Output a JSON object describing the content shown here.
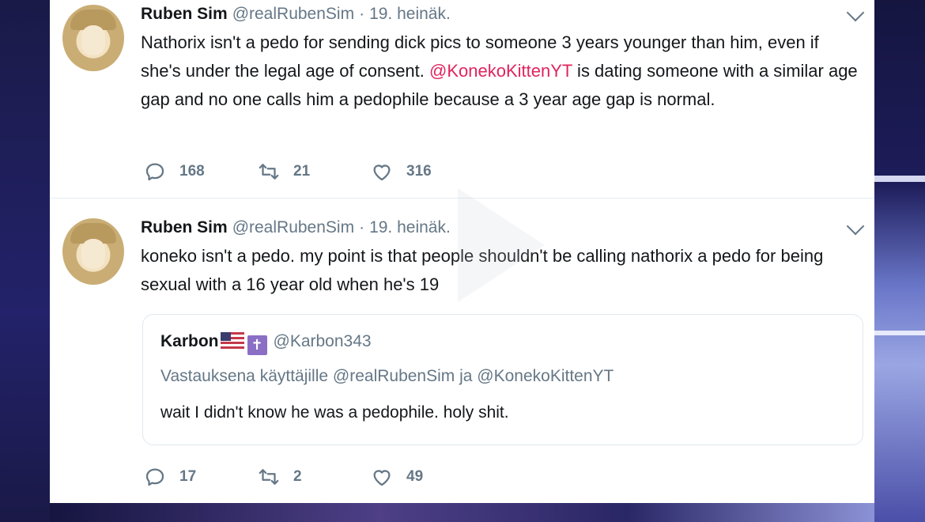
{
  "tweets": [
    {
      "author": {
        "name": "Ruben Sim",
        "handle": "@realRubenSim",
        "separator": "·",
        "date": "19. heinäk."
      },
      "text_before_mention": "Nathorix isn't a pedo for sending dick pics to someone 3 years younger than him, even if she's under the legal age of consent. ",
      "mention": "@KonekoKittenYT",
      "text_after_mention": " is dating someone with a similar age gap and no one calls him a pedophile because a 3 year age gap is normal.",
      "stats": {
        "replies": "168",
        "retweets": "21",
        "likes": "316"
      }
    },
    {
      "author": {
        "name": "Ruben Sim",
        "handle": "@realRubenSim",
        "separator": "·",
        "date": "19. heinäk."
      },
      "text": "koneko isn't a pedo. my point is that people shouldn't be calling nathorix a pedo for being sexual with a 16 year old when he's 19",
      "quote": {
        "name": "Karbon",
        "badge_glyph": "✝",
        "handle": "@Karbon343",
        "context": "Vastauksena käyttäjille @realRubenSim ja @KonekoKittenYT",
        "text": "wait I didn't know he was a pedophile. holy shit."
      },
      "stats": {
        "replies": "17",
        "retweets": "2",
        "likes": "49"
      }
    }
  ],
  "colors": {
    "text": "#14171a",
    "muted": "#657786",
    "mention": "#e0245e",
    "border": "#e1e8ed"
  },
  "icons": [
    "reply-icon",
    "retweet-icon",
    "like-icon",
    "chevron-down-icon"
  ]
}
